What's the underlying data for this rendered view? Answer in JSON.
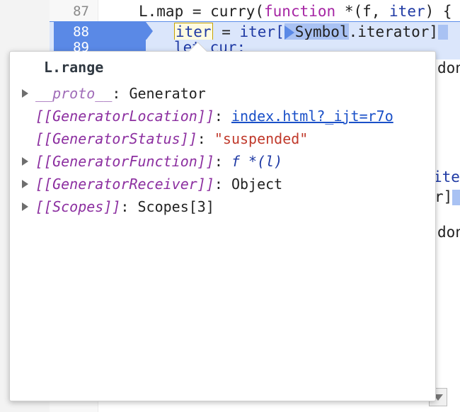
{
  "editor": {
    "lines": [
      {
        "num": "87",
        "code": {
          "p1": "L.map = curry(",
          "kw1": "function",
          "p2": " *(f, ",
          "var1": "iter",
          "p3": ") {"
        }
      },
      {
        "num": "88",
        "code": {
          "iter": "iter",
          "p1": " = ",
          "p2": "iter[",
          "sym": "Symbol",
          "p3": ".iterator]"
        }
      },
      {
        "num": "89",
        "code": {
          "p1": "let cur;"
        }
      }
    ],
    "right_fragments": [
      "don",
      "ite",
      "r]",
      "don"
    ]
  },
  "popover": {
    "title": "L.range",
    "properties": [
      {
        "key": "__proto__",
        "sep": ": ",
        "value": "Generator",
        "expandable": true,
        "kind": "plain"
      },
      {
        "key": "[[GeneratorLocation]]",
        "sep": ": ",
        "value": "index.html?_ijt=r7o",
        "expandable": false,
        "kind": "link"
      },
      {
        "key": "[[GeneratorStatus]]",
        "sep": ": ",
        "value": "\"suspended\"",
        "expandable": false,
        "kind": "string"
      },
      {
        "key": "[[GeneratorFunction]]",
        "sep": ": ",
        "value": "f *(l)",
        "expandable": true,
        "kind": "func"
      },
      {
        "key": "[[GeneratorReceiver]]",
        "sep": ": ",
        "value": "Object",
        "expandable": true,
        "kind": "plain"
      },
      {
        "key": "[[Scopes]]",
        "sep": ": ",
        "value": "Scopes[3]",
        "expandable": true,
        "kind": "plain"
      }
    ]
  },
  "colors": {
    "execution_line": "#5a89e6",
    "keyword": "#a626a4",
    "string": "#c0392b",
    "link": "#1a50c8"
  },
  "icons": {
    "step_marker": "execution-step-marker-icon",
    "expand": "expand-triangle-icon",
    "scroll_down": "chevron-down-icon"
  }
}
